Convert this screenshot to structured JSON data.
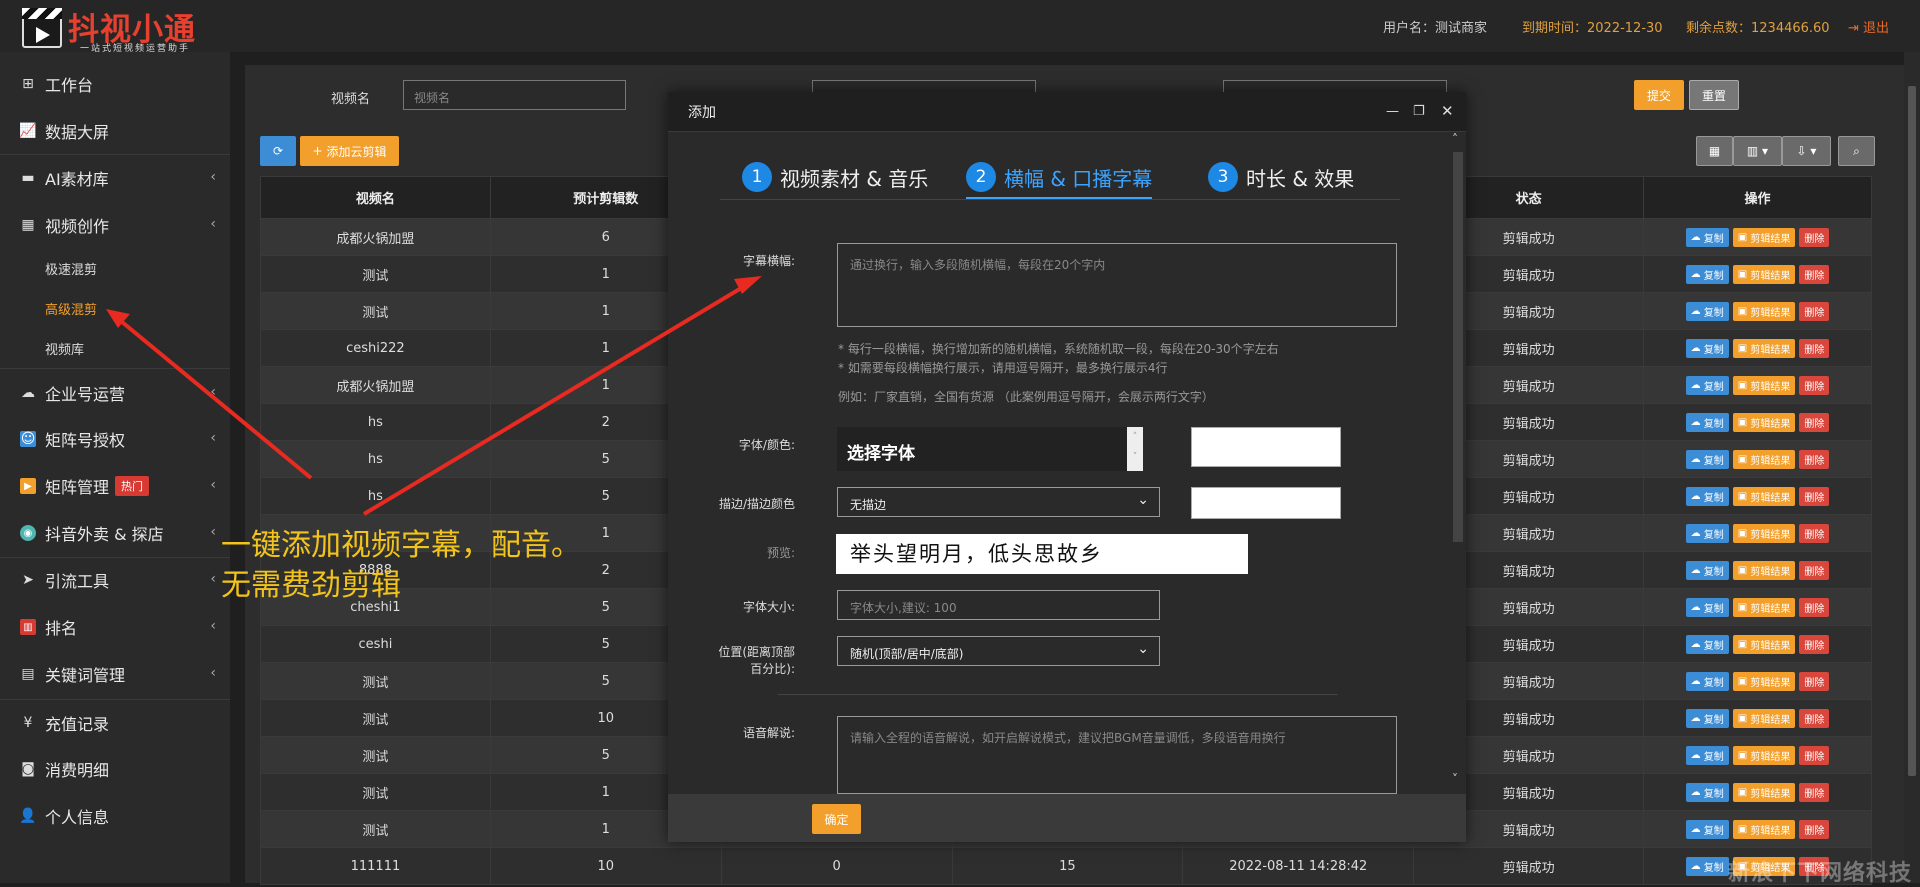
{
  "header": {
    "logo_name": "抖视小通",
    "logo_slogan": "一站式短视频运营助手",
    "username": "用户名：测试商家",
    "expire": "到期时间：2022-12-30",
    "points": "剩余点数：1234466.60",
    "logout": "退出"
  },
  "sidebar": {
    "items": [
      {
        "label": "工作台",
        "icon": "windows-icon"
      },
      {
        "label": "数据大屏",
        "icon": "chart-line-icon"
      },
      {
        "label": "AI素材库",
        "icon": "folder-icon"
      },
      {
        "label": "视频创作",
        "icon": "film-icon"
      },
      {
        "label": "极速混剪",
        "icon": ""
      },
      {
        "label": "高级混剪",
        "icon": ""
      },
      {
        "label": "视频库",
        "icon": ""
      },
      {
        "label": "企业号运营",
        "icon": "cloud-icon"
      },
      {
        "label": "矩阵号授权",
        "icon": "user-box-icon"
      },
      {
        "label": "矩阵管理",
        "icon": "play-icon",
        "badge": "热门"
      },
      {
        "label": "抖音外卖 & 探店",
        "icon": "globe-icon"
      },
      {
        "label": "引流工具",
        "icon": "send-icon"
      },
      {
        "label": "排名",
        "icon": "bar-chart-icon"
      },
      {
        "label": "关键词管理",
        "icon": "document-icon"
      },
      {
        "label": "充值记录",
        "icon": "yen-icon"
      },
      {
        "label": "消费明细",
        "icon": "money-icon"
      },
      {
        "label": "个人信息",
        "icon": "user-icon"
      }
    ]
  },
  "filters": {
    "video_name_label": "视频名",
    "video_name_placeholder": "视频名",
    "submit": "提交",
    "reset": "重置",
    "add_cloud": "添加云剪辑"
  },
  "table": {
    "headers": [
      "视频名",
      "预计剪辑数",
      "状态",
      "操作"
    ],
    "rows": [
      {
        "name": "成都火锅加盟",
        "count": "6",
        "status": "剪辑成功"
      },
      {
        "name": "测试",
        "count": "1",
        "status": "剪辑成功"
      },
      {
        "name": "测试",
        "count": "1",
        "status": "剪辑成功"
      },
      {
        "name": "ceshi222",
        "count": "1",
        "status": "剪辑成功"
      },
      {
        "name": "成都火锅加盟",
        "count": "1",
        "status": "剪辑成功"
      },
      {
        "name": "hs",
        "count": "2",
        "status": "剪辑成功"
      },
      {
        "name": "hs",
        "count": "5",
        "status": "剪辑成功"
      },
      {
        "name": "hs",
        "count": "5",
        "status": "剪辑成功"
      },
      {
        "name": "",
        "count": "1",
        "status": "剪辑成功"
      },
      {
        "name": "8888",
        "count": "2",
        "status": "剪辑成功"
      },
      {
        "name": "cheshi1",
        "count": "5",
        "status": "剪辑成功"
      },
      {
        "name": "ceshi",
        "count": "5",
        "status": "剪辑成功"
      },
      {
        "name": "测试",
        "count": "5",
        "status": "剪辑成功"
      },
      {
        "name": "测试",
        "count": "10",
        "status": "剪辑成功"
      },
      {
        "name": "测试",
        "count": "5",
        "status": "剪辑成功"
      },
      {
        "name": "测试",
        "count": "1",
        "status": "剪辑成功"
      },
      {
        "name": "测试",
        "count": "1",
        "status": "剪辑成功"
      },
      {
        "name": "111111",
        "count": "10",
        "status": "剪辑成功"
      }
    ],
    "last_row_extra": {
      "c3": "0",
      "c4": "15",
      "c5": "2022-08-11 14:28:42"
    },
    "op_copy": "复制",
    "op_result": "剪辑结果",
    "op_delete": "删除"
  },
  "callout": {
    "line1": "一键添加视频字幕，配音。",
    "line2": "无需费劲剪辑"
  },
  "modal": {
    "title": "添加",
    "steps": [
      {
        "num": "1",
        "label": "视频素材 & 音乐"
      },
      {
        "num": "2",
        "label": "横幅 & 口播字幕"
      },
      {
        "num": "3",
        "label": "时长 & 效果"
      }
    ],
    "banner_label": "字幕横幅:",
    "banner_placeholder": "通过换行，输入多段随机横幅，每段在20个字内",
    "hint1": "* 每行一段横幅，换行增加新的随机横幅，系统随机取一段，每段在20-30个字左右",
    "hint2": "* 如需要每段横幅换行展示，请用逗号隔开，最多换行展示4行",
    "hint3": "例如：厂家直销，全国有货源 （此案例用逗号隔开，会展示两行文字）",
    "font_label": "字体/颜色:",
    "font_select": "选择字体",
    "stroke_label": "描边/描边颜色",
    "stroke_value": "无描边",
    "preview_label": "预览:",
    "preview_text": "举头望明月，低头思故乡",
    "size_label": "字体大小:",
    "size_placeholder": "字体大小,建议: 100",
    "position_label_1": "位置(距离顶部",
    "position_label_2": "百分比):",
    "position_value": "随机(顶部/居中/底部)",
    "voice_label": "语音解说:",
    "voice_placeholder": "请输入全程的语音解说，如开启解说模式，建议把BGM音量调低，多段语音用换行",
    "confirm": "确定"
  },
  "watermark": "新浪下下网络科技"
}
